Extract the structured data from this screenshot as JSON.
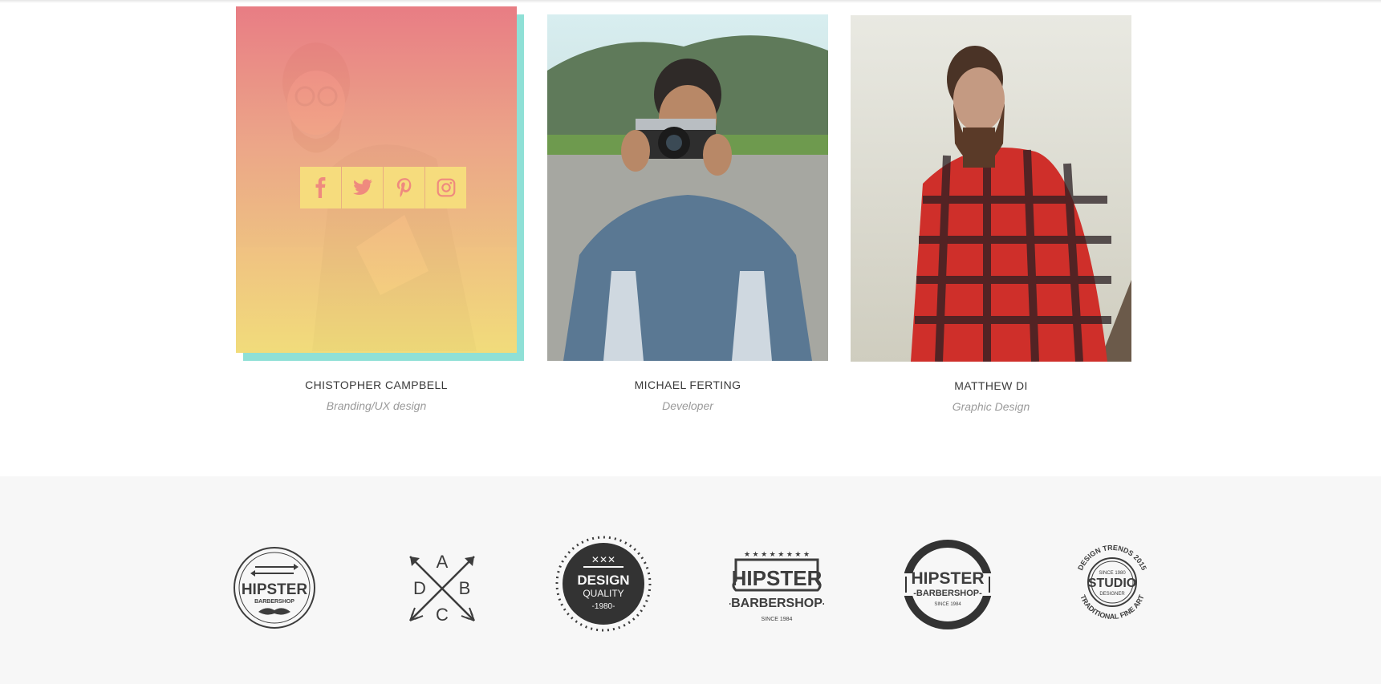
{
  "team": {
    "members": [
      {
        "name": "CHISTOPHER CAMPBELL",
        "role": "Branding/UX design",
        "photo_alt": "man-with-glasses-photo"
      },
      {
        "name": "MICHAEL FERTING",
        "role": "Developer",
        "photo_alt": "man-with-camera-photo"
      },
      {
        "name": "MATTHEW DI",
        "role": "Graphic Design",
        "photo_alt": "bearded-man-in-red-plaid-photo"
      }
    ],
    "social_icons": [
      "facebook-icon",
      "twitter-icon",
      "pinterest-icon",
      "instagram-icon"
    ]
  },
  "clients": {
    "logos": [
      {
        "id": "hipster-barbershop-round",
        "line1": "HIPSTER",
        "line2": "BARBERSHOP"
      },
      {
        "id": "abcd-arrows",
        "letters": [
          "A",
          "B",
          "C",
          "D"
        ]
      },
      {
        "id": "design-quality",
        "line1": "DESIGN",
        "line2": "QUALITY",
        "line3": "-1980-"
      },
      {
        "id": "hipster-barbershop-ribbon",
        "line1": "HIPSTER",
        "line2": "-BARBERSHOP-",
        "line3": "SINCE 1984"
      },
      {
        "id": "hipster-barbershop-badge",
        "line1": "HIPSTER",
        "line2": "-BARBERSHOP-",
        "line3": "SINCE 1984"
      },
      {
        "id": "studio-designer",
        "top": "DESIGN TRENDS 2015",
        "line1": "SINCE 1980",
        "line2": "STUDIO",
        "line3": "DESIGNER",
        "bottom": "TRADITIONAL FINE ART"
      }
    ]
  },
  "colors": {
    "overlay_top": "#ef7c84",
    "overlay_bottom": "#f6df7a",
    "shadow_block": "#8fe0d6",
    "social_tile": "#f6dc7d",
    "social_icon": "#ef8a7e",
    "client_band": "#f7f7f7",
    "logo_dark": "#3d3d3d"
  }
}
